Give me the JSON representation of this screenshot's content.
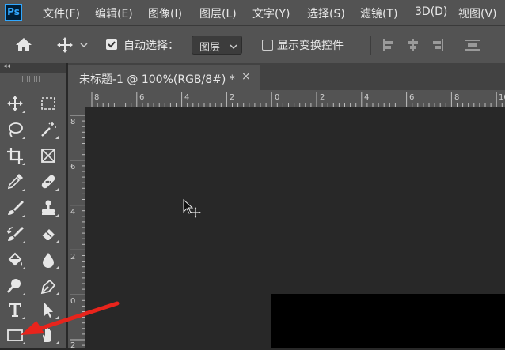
{
  "app": {
    "logo": "Ps"
  },
  "menu": [
    "文件(F)",
    "编辑(E)",
    "图像(I)",
    "图层(L)",
    "文字(Y)",
    "选择(S)",
    "滤镜(T)",
    "3D(D)",
    "视图(V)"
  ],
  "options": {
    "auto_select_label": "自动选择：",
    "auto_select_checked": true,
    "layer_select_value": "图层",
    "show_transform_label": "显示变换控件",
    "show_transform_checked": false
  },
  "toolbar": {
    "collapse_glyph": "◂◂",
    "tools": [
      [
        "move-tool",
        "marquee-tool"
      ],
      [
        "lasso-tool",
        "magic-wand-tool"
      ],
      [
        "crop-tool",
        "frame-tool"
      ],
      [
        "eyedropper-tool",
        "healing-brush-tool"
      ],
      [
        "brush-tool",
        "clone-stamp-tool"
      ],
      [
        "history-brush-tool",
        "eraser-tool"
      ],
      [
        "paint-bucket-tool",
        "blur-tool"
      ],
      [
        "dodge-tool",
        "pen-tool"
      ],
      [
        "type-tool",
        "path-selection-tool"
      ],
      [
        "rectangle-tool",
        "hand-tool"
      ]
    ]
  },
  "document": {
    "tab_title": "未标题-1 @ 100%(RGB/8#) *",
    "close_glyph": "×"
  },
  "rulers": {
    "horizontal": [
      "8",
      "6",
      "4",
      "2",
      "0",
      "2",
      "4",
      "6",
      "8",
      "10"
    ],
    "vertical": [
      "8",
      "6",
      "4",
      "2",
      "0",
      "2"
    ]
  },
  "colors": {
    "annotation_arrow": "#e8241c",
    "accent": "#31a8ff"
  }
}
